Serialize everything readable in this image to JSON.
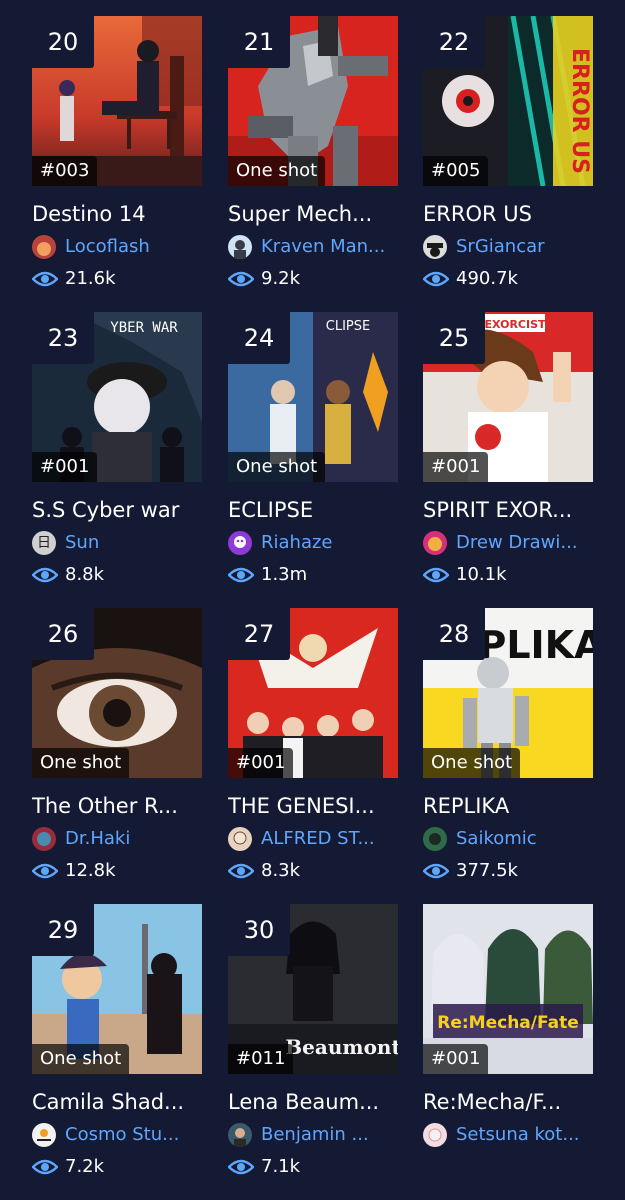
{
  "colors": {
    "background": "#141a33",
    "author_link": "#5fa6ff",
    "eye_icon": "#5fa6ff"
  },
  "cards": [
    {
      "rank": "20",
      "badge": "#003",
      "title": "Destino 14",
      "author": "Locoflash",
      "views": "21.6k",
      "avatar_color": "#b8433a",
      "cover": "sunset-bench"
    },
    {
      "rank": "21",
      "badge": "One shot",
      "title": "Super Mech...",
      "author": "Kraven Man...",
      "views": "9.2k",
      "avatar_color": "#cfe4f0",
      "cover": "red-mech"
    },
    {
      "rank": "22",
      "badge": "#005",
      "title": "ERROR US",
      "author": "SrGiancar",
      "views": "490.7k",
      "avatar_color": "#dcdcdc",
      "cover": "error-us",
      "cover_text": "ERROR US"
    },
    {
      "rank": "23",
      "badge": "#001",
      "title": "S.S Cyber war",
      "author": "Sun",
      "views": "8.8k",
      "avatar_color": "#d0d0d0",
      "avatar_glyph": "日",
      "cover": "cyber-war",
      "cover_text": "YBER WAR"
    },
    {
      "rank": "24",
      "badge": "One shot",
      "title": "ECLIPSE",
      "author": "Riahaze",
      "views": "1.3m",
      "avatar_color": "#8e3ad6",
      "cover": "eclipse",
      "cover_text": "CLIPSE"
    },
    {
      "rank": "25",
      "badge": "#001",
      "title": "SPIRIT EXOR...",
      "author": "Drew Drawi...",
      "views": "10.1k",
      "avatar_color": "#d6307a",
      "cover": "spirit",
      "cover_text": "EXORCIST"
    },
    {
      "rank": "26",
      "badge": "One shot",
      "title": "The Other R...",
      "author": "Dr.Haki",
      "views": "12.8k",
      "avatar_color": "#9a2b3a",
      "cover": "eye"
    },
    {
      "rank": "27",
      "badge": "#001",
      "title": "THE GENESI...",
      "author": "ALFRED ST...",
      "views": "8.3k",
      "avatar_color": "#e8d3c0",
      "cover": "genesis"
    },
    {
      "rank": "28",
      "badge": "One shot",
      "title": "REPLIKA",
      "author": "Saikomic",
      "views": "377.5k",
      "avatar_color": "#2f6b4a",
      "cover": "replika",
      "cover_text": "PLIKA"
    },
    {
      "rank": "29",
      "badge": "One shot",
      "title": "Camila Shad...",
      "author": "Cosmo Stu...",
      "views": "7.2k",
      "avatar_color": "#f2f2f2",
      "cover": "camila"
    },
    {
      "rank": "30",
      "badge": "#011",
      "title": "Lena Beaum...",
      "author": "Benjamin ...",
      "views": "7.1k",
      "avatar_color": "#3a5a6a",
      "cover": "lena",
      "cover_text": "Beaumont"
    },
    {
      "rank": "",
      "badge": "#001",
      "title": "Re:Mecha/F...",
      "author": "Setsuna kot...",
      "views": "",
      "avatar_color": "#f4dbe0",
      "cover": "remecha",
      "cover_text": "Re:Mecha/Fate"
    }
  ]
}
